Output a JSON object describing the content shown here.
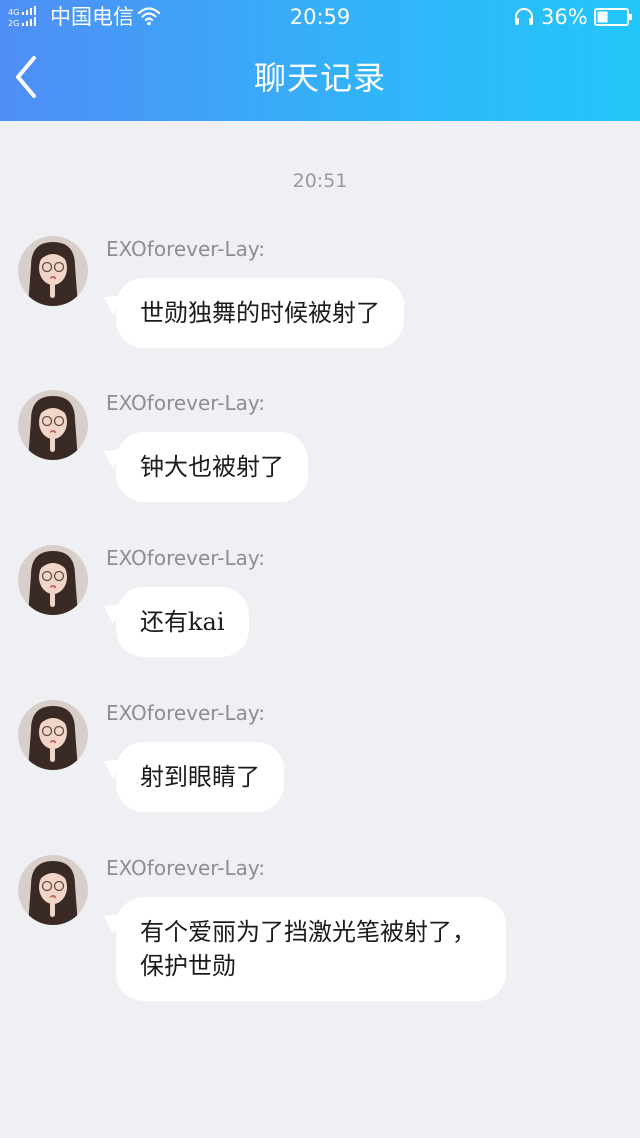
{
  "status_bar": {
    "carrier": "中国电信",
    "network_labels": [
      "4G",
      "2G"
    ],
    "time": "20:59",
    "battery": "36%"
  },
  "header": {
    "title": "聊天记录",
    "back_icon": "chevron-left-icon"
  },
  "conversation": {
    "timestamp": "20:51",
    "messages": [
      {
        "sender": "EXOforever-Lay:",
        "text": "世勋独舞的时候被射了"
      },
      {
        "sender": "EXOforever-Lay:",
        "text": "钟大也被射了"
      },
      {
        "sender": "EXOforever-Lay:",
        "text": "还有kai"
      },
      {
        "sender": "EXOforever-Lay:",
        "text": "射到眼睛了"
      },
      {
        "sender": "EXOforever-Lay:",
        "text": "有个爱丽为了挡激光笔被射了，保护世勋"
      }
    ]
  },
  "colors": {
    "header_gradient_start": "#4f8ef6",
    "header_gradient_end": "#22c6f9",
    "background": "#eff0f4",
    "bubble": "#ffffff",
    "sender_text": "#8d8d92"
  }
}
